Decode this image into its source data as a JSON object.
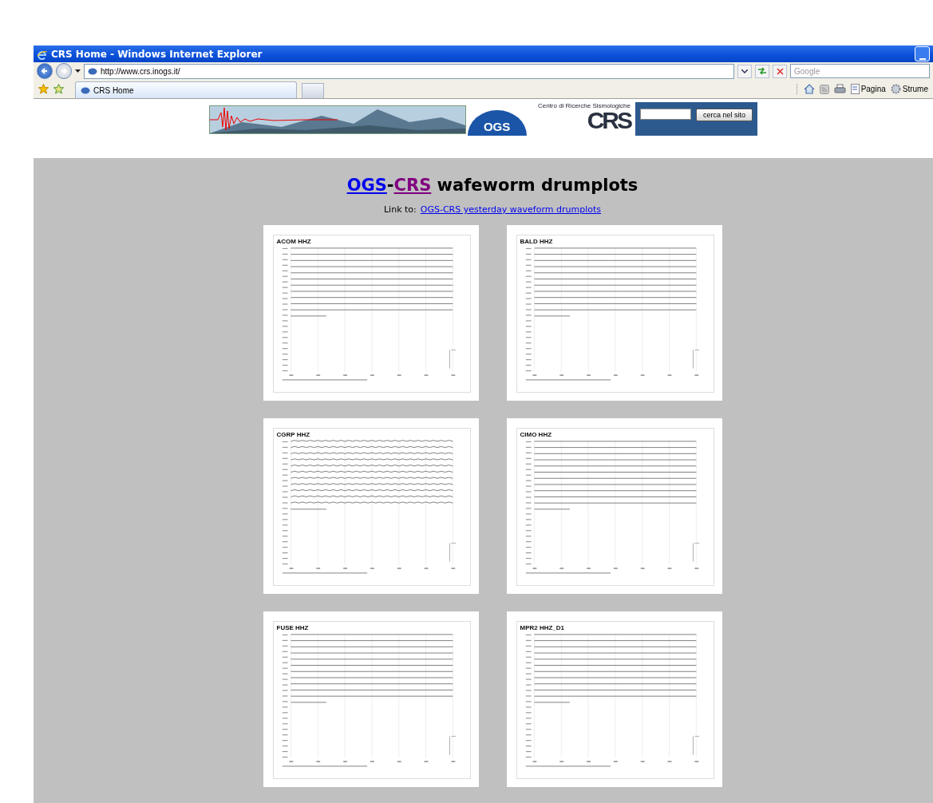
{
  "window": {
    "title": "CRS Home - Windows Internet Explorer"
  },
  "address_bar": {
    "url": "http://www.crs.inogs.it/"
  },
  "search": {
    "placeholder": "Google"
  },
  "tabs": [
    {
      "label": "CRS Home",
      "selected": true
    }
  ],
  "command_bar": {
    "items": [
      {
        "kind": "home"
      },
      {
        "kind": "feeds"
      },
      {
        "kind": "print"
      },
      {
        "kind": "menu",
        "label": "Pagina"
      },
      {
        "kind": "tools",
        "label": "Strume"
      }
    ]
  },
  "banner": {
    "logo_text": "OGS",
    "tagline": "Centro di Ricerche Sismologiche",
    "crs_logo": "CRS",
    "search_button": "cerca nel sito"
  },
  "heading": {
    "links": [
      {
        "text": "OGS",
        "visited": false
      },
      {
        "text": "CRS",
        "visited": true
      }
    ],
    "separator": "-",
    "rest": "wafeworm drumplots"
  },
  "link_line": {
    "label": "Link to:",
    "link": "OGS-CRS yesterday waveform drumplots"
  },
  "plots": [
    {
      "title": "ACOM HHZ",
      "kind": "flat"
    },
    {
      "title": "BALD HHZ",
      "kind": "flat"
    },
    {
      "title": "CGRP HHZ",
      "kind": "wavy"
    },
    {
      "title": "CIMO HHZ",
      "kind": "flat"
    },
    {
      "title": "FUSE HHZ",
      "kind": "flat"
    },
    {
      "title": "MPR2 HHZ_D1",
      "kind": "flat"
    }
  ]
}
